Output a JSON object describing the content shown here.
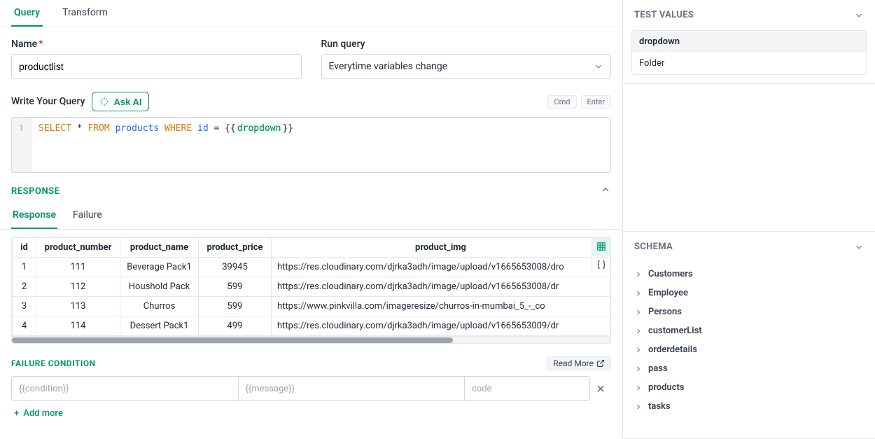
{
  "tabs": {
    "query": "Query",
    "transform": "Transform"
  },
  "form": {
    "name_label": "Name",
    "name_value": "productlist",
    "run_label": "Run query",
    "run_selected": "Everytime variables change"
  },
  "write": {
    "label": "Write Your Query",
    "ask_ai": "Ask AI",
    "cmd_hint": "Cmd",
    "enter_hint": "Enter"
  },
  "code": {
    "line_no": "1",
    "seg_select": "SELECT",
    "seg_star": "*",
    "seg_from": "FROM",
    "seg_products": "products",
    "seg_where": "WHERE",
    "seg_id": "id",
    "seg_eq": "=",
    "seg_open": "{{",
    "seg_var": "dropdown",
    "seg_close": "}}"
  },
  "response": {
    "title": "RESPONSE",
    "tab_response": "Response",
    "tab_failure": "Failure",
    "columns": {
      "id": "id",
      "pnum": "product_number",
      "pname": "product_name",
      "pprice": "product_price",
      "pimg": "product_img"
    },
    "rows": [
      {
        "idx": "1",
        "pnum": "111",
        "pname": "Beverage Pack1",
        "pprice": "39945",
        "pimg": "https://res.cloudinary.com/djrka3adh/image/upload/v1665653008/dro"
      },
      {
        "idx": "2",
        "pnum": "112",
        "pname": "Houshold Pack",
        "pprice": "599",
        "pimg": "https://res.cloudinary.com/djrka3adh/image/upload/v1665653008/dr"
      },
      {
        "idx": "3",
        "pnum": "113",
        "pname": "Churros",
        "pprice": "599",
        "pimg": "https://www.pinkvilla.com/imageresize/churros-in-mumbai_5_-_co"
      },
      {
        "idx": "4",
        "pnum": "114",
        "pname": "Dessert Pack1",
        "pprice": "499",
        "pimg": "https://res.cloudinary.com/djrka3adh/image/upload/v1665653009/dr"
      }
    ]
  },
  "failure": {
    "title": "FAILURE CONDITION",
    "read_more": "Read More",
    "ph_condition": "{{condition}}",
    "ph_message": "{{message}}",
    "ph_code": "code",
    "add_more": "Add more"
  },
  "side": {
    "test_values": {
      "title": "TEST VALUES",
      "header": "dropdown",
      "value": "Folder"
    },
    "schema": {
      "title": "SCHEMA",
      "items": [
        "Customers",
        "Employee",
        "Persons",
        "customerList",
        "orderdetails",
        "pass",
        "products",
        "tasks"
      ]
    }
  }
}
